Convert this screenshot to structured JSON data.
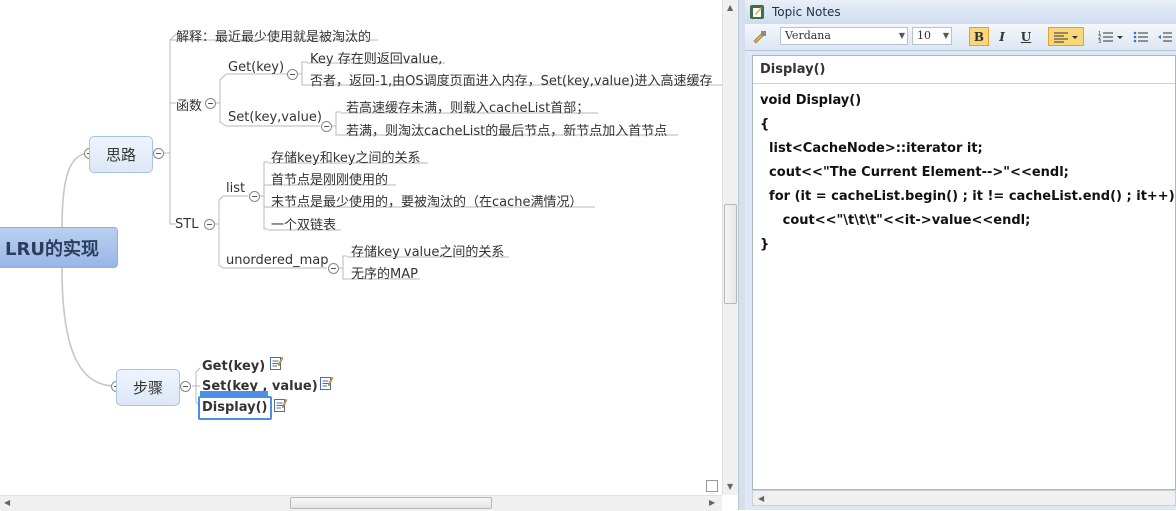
{
  "mindmap": {
    "root": "LRU的实现",
    "branch1": {
      "title": "思路",
      "explain": "解释：最近最少使用就是被淘汰的",
      "func": {
        "title": "函数",
        "get": {
          "title": "Get(key)",
          "items": [
            "Key 存在则返回value,",
            "否者，返回-1,由OS调度页面进入内存，Set(key,value)进入高速缓存"
          ]
        },
        "set": {
          "title": "Set(key,value)",
          "items": [
            "若高速缓存未满，则载入cacheList首部；",
            "若满，则淘汰cacheList的最后节点，新节点加入首节点"
          ]
        }
      },
      "stl": {
        "title": "STL",
        "list": {
          "title": "list",
          "items": [
            "存储key和key之间的关系",
            "首节点是刚刚使用的",
            "末节点是最少使用的，要被淘汰的（在cache满情况）",
            "一个双链表"
          ]
        },
        "umap": {
          "title": "unordered_map",
          "items": [
            "存储key value之间的关系",
            "无序的MAP"
          ]
        }
      }
    },
    "branch2": {
      "title": "步骤",
      "steps": [
        "Get(key)",
        "Set(key , value)",
        "Display()"
      ]
    }
  },
  "notes": {
    "title": "Topic Notes",
    "font": "Verdana",
    "size": "10",
    "bold": "B",
    "italic": "I",
    "underline": "U",
    "heading": "Display()",
    "code": [
      "void Display()",
      "{",
      "  list<CacheNode>::iterator it;",
      "  cout<<\"The Current Element-->\"<<endl;",
      "  for (it = cacheList.begin() ; it != cacheList.end() ; it++)",
      "     cout<<\"\\t\\t\\t\"<<it->value<<endl;",
      "}"
    ]
  },
  "colors": {
    "accent": "#4c8ee6",
    "root_fill": "#a9c3ec",
    "node_fill": "#e6eefa",
    "link": "#c8c8c8"
  }
}
